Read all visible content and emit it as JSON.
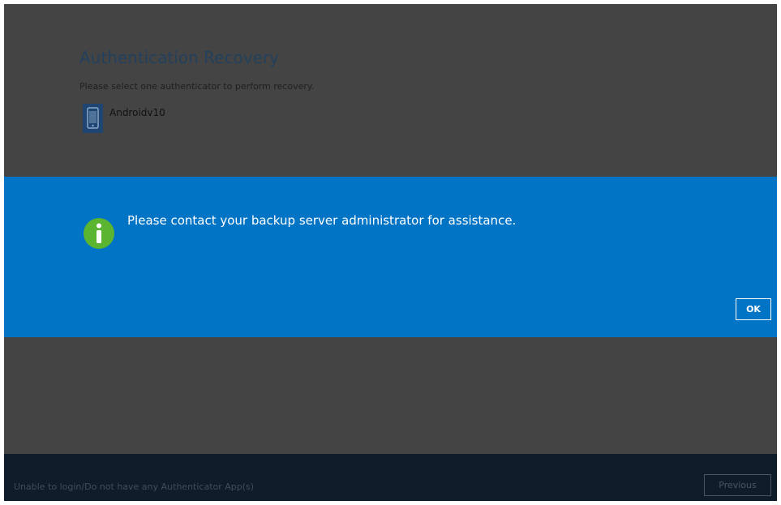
{
  "page": {
    "title": "Authentication Recovery",
    "subtitle": "Please select one authenticator to perform recovery.",
    "authenticators": [
      {
        "label": "Androidv10",
        "icon": "mobile-phone-icon"
      }
    ]
  },
  "dialog": {
    "icon": "info-icon",
    "message": "Please contact your backup server administrator for assistance.",
    "ok_label": "OK",
    "background_color": "#0274c6"
  },
  "footer": {
    "help_link": "Unable to login/Do not have any Authenticator App(s)",
    "previous_label": "Previous"
  },
  "colors": {
    "overlay_background": "#444444",
    "footer_background": "#0f1d2b",
    "info_icon_color": "#5cb531"
  }
}
